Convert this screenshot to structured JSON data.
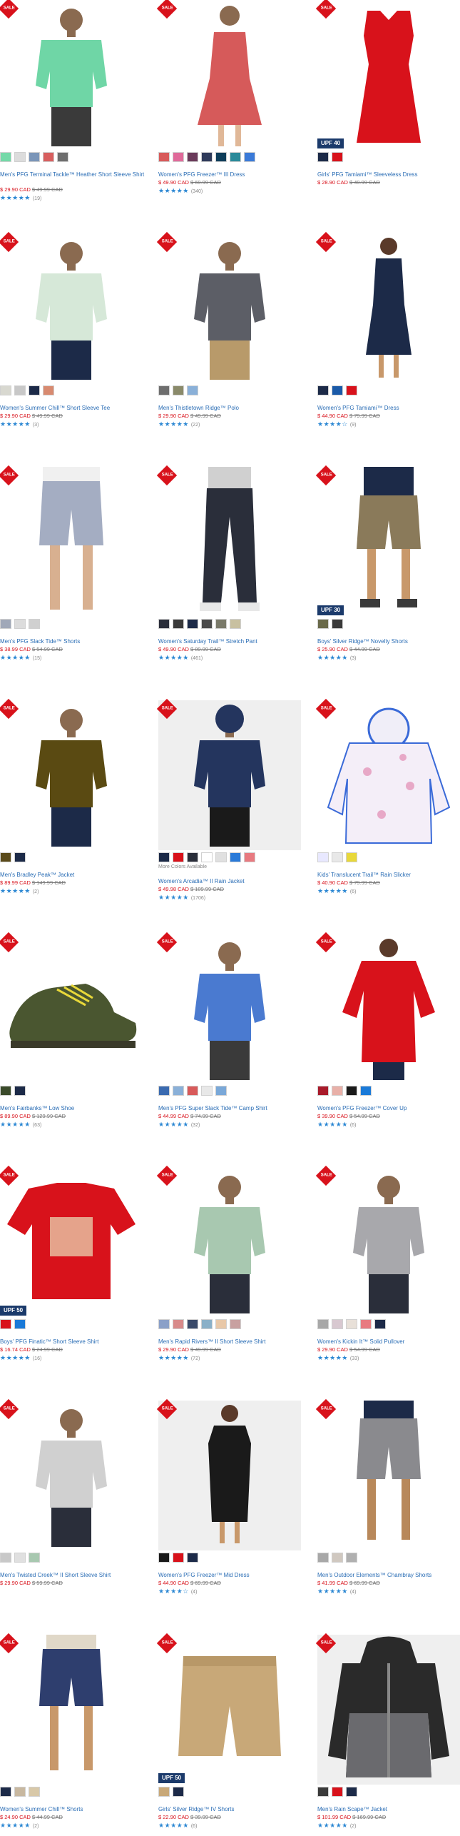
{
  "sale_label": "SALE",
  "products": [
    {
      "name": "Men's PFG Terminal Tackle™ Heather Short Sleeve Shirt",
      "price_now": "$ 29.90 CAD",
      "price_was": "$ 49.99 CAD",
      "rating": 5,
      "reviews": "(19)",
      "swatches": [
        "#74d9a8",
        "#dcdcdc",
        "#7a95b8",
        "#d85f5f",
        "#6e6e6e"
      ],
      "upf": "",
      "more": "",
      "image": "tee-mint"
    },
    {
      "name": "Women's PFG Freezer™ III Dress",
      "price_now": "$ 49.90 CAD",
      "price_was": "$ 69.99 CAD",
      "rating": 5,
      "reviews": "(340)",
      "swatches": [
        "#d85a5a",
        "#e06a9a",
        "#6a3a5a",
        "#2e3a5a",
        "#0e3d5a",
        "#2a8a9a",
        "#3a7ad8"
      ],
      "upf": "",
      "more": "",
      "image": "dress-coral"
    },
    {
      "name": "Girls' PFG Tamiami™ Sleeveless Dress",
      "price_now": "$ 28.90 CAD",
      "price_was": "$ 49.99 CAD",
      "rating": 0,
      "reviews": "",
      "swatches": [
        "#1c2a48",
        "#d8121b"
      ],
      "upf": "UPF 40",
      "more": "",
      "image": "dress-red"
    },
    {
      "name": "Women's Summer Chill™ Short Sleeve Tee",
      "price_now": "$ 29.90 CAD",
      "price_was": "$ 49.99 CAD",
      "rating": 5,
      "reviews": "(3)",
      "swatches": [
        "#d8d8d0",
        "#c8c8c8",
        "#1c2a48",
        "#d88a70"
      ],
      "upf": "",
      "more": "",
      "image": "tee-sage"
    },
    {
      "name": "Men's Thistletown Ridge™ Polo",
      "price_now": "$ 29.90 CAD",
      "price_was": "$ 49.99 CAD",
      "rating": 5,
      "reviews": "(22)",
      "swatches": [
        "#6e6e6e",
        "#8a8a6a",
        "#8ab0d8"
      ],
      "upf": "",
      "more": "",
      "image": "polo-gray"
    },
    {
      "name": "Women's PFG Tamiami™ Dress",
      "price_now": "$ 44.90 CAD",
      "price_was": "$ 79.99 CAD",
      "rating": 4,
      "reviews": "(9)",
      "swatches": [
        "#1c2a48",
        "#1a5aa8",
        "#d8121b"
      ],
      "upf": "",
      "more": "",
      "image": "dress-navy"
    },
    {
      "name": "Men's PFG Slack Tide™ Shorts",
      "price_now": "$ 38.99 CAD",
      "price_was": "$ 54.99 CAD",
      "rating": 5,
      "reviews": "(15)",
      "swatches": [
        "#a0a8b8",
        "#dcdcdc",
        "#d0d0d0"
      ],
      "upf": "",
      "more": "",
      "image": "shorts-blue"
    },
    {
      "name": "Women's Saturday Trail™ Stretch Pant",
      "price_now": "$ 49.90 CAD",
      "price_was": "$ 89.99 CAD",
      "rating": 5,
      "reviews": "(461)",
      "swatches": [
        "#2a2e3a",
        "#3a3a3a",
        "#1c2a48",
        "#4a4a4a",
        "#7a7a6a",
        "#c8c0a0"
      ],
      "upf": "",
      "more": "",
      "image": "pants-navy"
    },
    {
      "name": "Boys' Silver Ridge™ Novelty Shorts",
      "price_now": "$ 25.90 CAD",
      "price_was": "$ 44.99 CAD",
      "rating": 5,
      "reviews": "(3)",
      "swatches": [
        "#6a6a4a",
        "#3a3a3a"
      ],
      "upf": "UPF 30",
      "more": "",
      "image": "shorts-camo"
    },
    {
      "name": "Men's Bradley Peak™ Jacket",
      "price_now": "$ 89.99 CAD",
      "price_was": "$ 149.99 CAD",
      "rating": 5,
      "reviews": "(2)",
      "swatches": [
        "#5a4a1a",
        "#1c2a48"
      ],
      "upf": "",
      "more": "",
      "image": "jacket-olive"
    },
    {
      "name": "Women's Arcadia™ II Rain Jacket",
      "price_now": "$ 49.98 CAD",
      "price_was": "$ 109.99 CAD",
      "rating": 5,
      "reviews": "(1706)",
      "swatches": [
        "#1c2a48",
        "#d8121b",
        "#2a2e3a",
        "#ffffff",
        "#e0e0e0",
        "#2a7ad8",
        "#e87a80"
      ],
      "upf": "",
      "more": "More Colors Available",
      "image": "jacket-navy"
    },
    {
      "name": "Kids' Translucent Trail™ Rain Slicker",
      "price_now": "$ 40.90 CAD",
      "price_was": "$ 79.99 CAD",
      "rating": 5,
      "reviews": "(6)",
      "swatches": [
        "#e8e8ff",
        "#e8e8e8",
        "#e8d83a"
      ],
      "upf": "",
      "more": "",
      "image": "slicker"
    },
    {
      "name": "Men's Fairbanks™ Low Shoe",
      "price_now": "$ 89.90 CAD",
      "price_was": "$ 129.99 CAD",
      "rating": 5,
      "reviews": "(63)",
      "swatches": [
        "#3a4a2a",
        "#1c2a48"
      ],
      "upf": "",
      "more": "",
      "image": "shoe"
    },
    {
      "name": "Men's PFG Super Slack Tide™ Camp Shirt",
      "price_now": "$ 44.99 CAD",
      "price_was": "$ 74.99 CAD",
      "rating": 5,
      "reviews": "(32)",
      "swatches": [
        "#3a6ab0",
        "#8ab0d8",
        "#d85a5a",
        "#e8e8e8",
        "#7aa8d8"
      ],
      "upf": "",
      "more": "",
      "image": "shirt-print"
    },
    {
      "name": "Women's PFG Freezer™ Cover Up",
      "price_now": "$ 39.90 CAD",
      "price_was": "$ 54.99 CAD",
      "rating": 5,
      "reviews": "(6)",
      "swatches": [
        "#a81a2a",
        "#e8b0a8",
        "#1a1a1a",
        "#1a7ad8"
      ],
      "upf": "",
      "more": "",
      "image": "coverup-red"
    },
    {
      "name": "Boys' PFG Finatic™ Short Sleeve Shirt",
      "price_now": "$ 16.74 CAD",
      "price_was": "$ 24.99 CAD",
      "rating": 5,
      "reviews": "(16)",
      "swatches": [
        "#d8121b",
        "#1a7ad8"
      ],
      "upf": "UPF 50",
      "more": "",
      "image": "tee-red"
    },
    {
      "name": "Men's Rapid Rivers™ II Short Sleeve Shirt",
      "price_now": "$ 29.90 CAD",
      "price_was": "$ 49.99 CAD",
      "rating": 5,
      "reviews": "(72)",
      "swatches": [
        "#8aa0c8",
        "#d88a8a",
        "#3a4a6a",
        "#8ab0c8",
        "#e8c8a8",
        "#c8a0a0"
      ],
      "upf": "",
      "more": "",
      "image": "shirt-plaid"
    },
    {
      "name": "Women's Kickin It™ Solid Pullover",
      "price_now": "$ 29.90 CAD",
      "price_was": "$ 54.99 CAD",
      "rating": 5,
      "reviews": "(33)",
      "swatches": [
        "#a8a8a8",
        "#d8c8d0",
        "#e8e0d8",
        "#e87a80",
        "#1c2a48"
      ],
      "upf": "",
      "more": "",
      "image": "pullover-gray"
    },
    {
      "name": "Men's Twisted Creek™ II Short Sleeve Shirt",
      "price_now": "$ 29.90 CAD",
      "price_was": "$ 59.99 CAD",
      "rating": 0,
      "reviews": "",
      "swatches": [
        "#c8c8c8",
        "#e0e0e0",
        "#a8c8b0"
      ],
      "upf": "",
      "more": "",
      "image": "shirt-check"
    },
    {
      "name": "Women's PFG Freezer™ Mid Dress",
      "price_now": "$ 44.90 CAD",
      "price_was": "$ 69.99 CAD",
      "rating": 4,
      "reviews": "(4)",
      "swatches": [
        "#1a1a1a",
        "#d8121b",
        "#1c2a48"
      ],
      "upf": "",
      "more": "",
      "image": "dress-black"
    },
    {
      "name": "Men's Outdoor Elements™ Chambray Shorts",
      "price_now": "$ 41.99 CAD",
      "price_was": "$ 69.99 CAD",
      "rating": 5,
      "reviews": "(4)",
      "swatches": [
        "#a8a8a8",
        "#d0c8c0",
        "#b0b0b0"
      ],
      "upf": "",
      "more": "",
      "image": "shorts-gray"
    },
    {
      "name": "Women's Summer Chill™ Shorts",
      "price_now": "$ 24.90 CAD",
      "price_was": "$ 44.99 CAD",
      "rating": 5,
      "reviews": "(2)",
      "swatches": [
        "#1c2a48",
        "#c8b8a0",
        "#d8c8a8"
      ],
      "upf": "",
      "more": "",
      "image": "shorts-navy"
    },
    {
      "name": "Girls' Silver Ridge™ IV Shorts",
      "price_now": "$ 22.90 CAD",
      "price_was": "$ 39.99 CAD",
      "rating": 5,
      "reviews": "(6)",
      "swatches": [
        "#c8a878",
        "#1c2a48"
      ],
      "upf": "UPF 50",
      "more": "",
      "image": "shorts-khaki"
    },
    {
      "name": "Men's Rain Scape™ Jacket",
      "price_now": "$ 101.99 CAD",
      "price_was": "$ 169.99 CAD",
      "rating": 5,
      "reviews": "(2)",
      "swatches": [
        "#3a3a3a",
        "#d8121b",
        "#1c2a48"
      ],
      "upf": "",
      "more": "",
      "image": "jacket-rain"
    }
  ]
}
